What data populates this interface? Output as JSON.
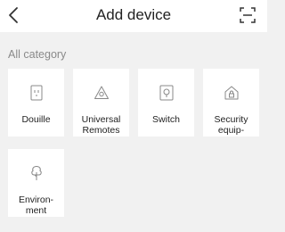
{
  "header": {
    "title": "Add device"
  },
  "section_label": "All category",
  "categories": [
    {
      "label": "Douille",
      "icon": "socket-icon"
    },
    {
      "label": "Universal\nRemotes",
      "icon": "remote-triangle-icon"
    },
    {
      "label": "Switch",
      "icon": "switch-icon"
    },
    {
      "label": "Security\nequip-",
      "icon": "house-lock-icon"
    },
    {
      "label": "Environ-\nment",
      "icon": "tree-icon"
    }
  ]
}
